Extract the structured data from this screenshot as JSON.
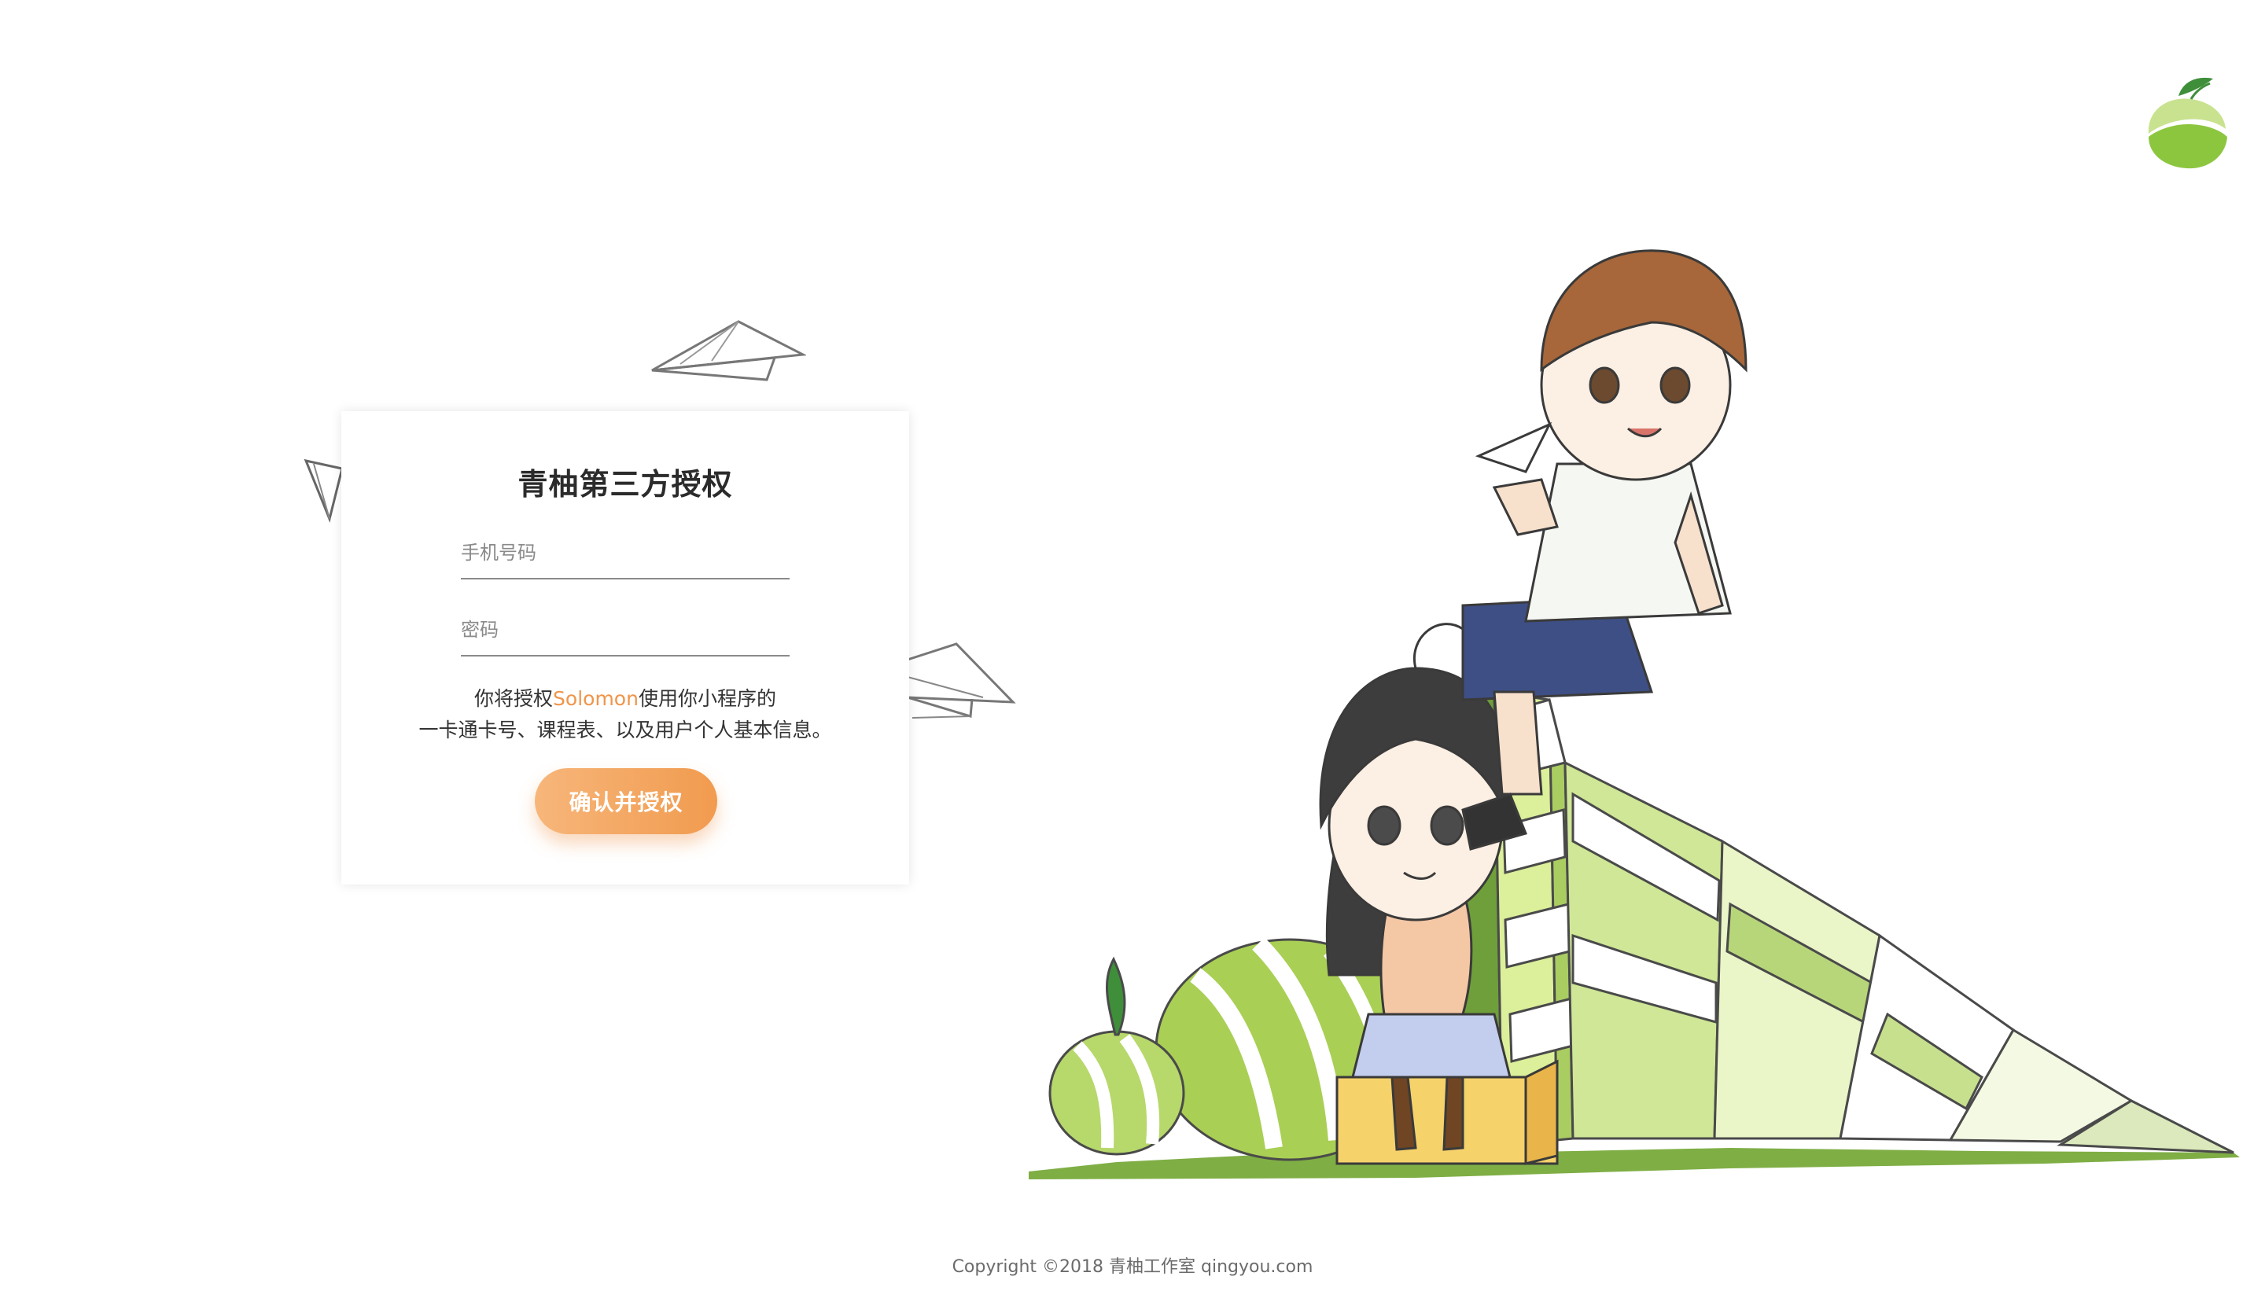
{
  "auth": {
    "title": "青柚第三方授权",
    "phone_placeholder": "手机号码",
    "password_placeholder": "密码",
    "desc_prefix": "你将授权",
    "app_name": "Solomon",
    "desc_suffix": "使用你小程序的",
    "desc_line2": "一卡通卡号、课程表、以及用户个人基本信息。",
    "confirm_label": "确认并授权"
  },
  "footer": {
    "copyright": "Copyright ©2018 青柚工作室 qingyou.com"
  },
  "icons": {
    "logo": "qingyou-fruit-logo",
    "planes": "paper-plane-icon"
  },
  "colors": {
    "accent": "#f19b4f",
    "app_name": "#f0954a",
    "brand_green": "#8cc63f"
  }
}
